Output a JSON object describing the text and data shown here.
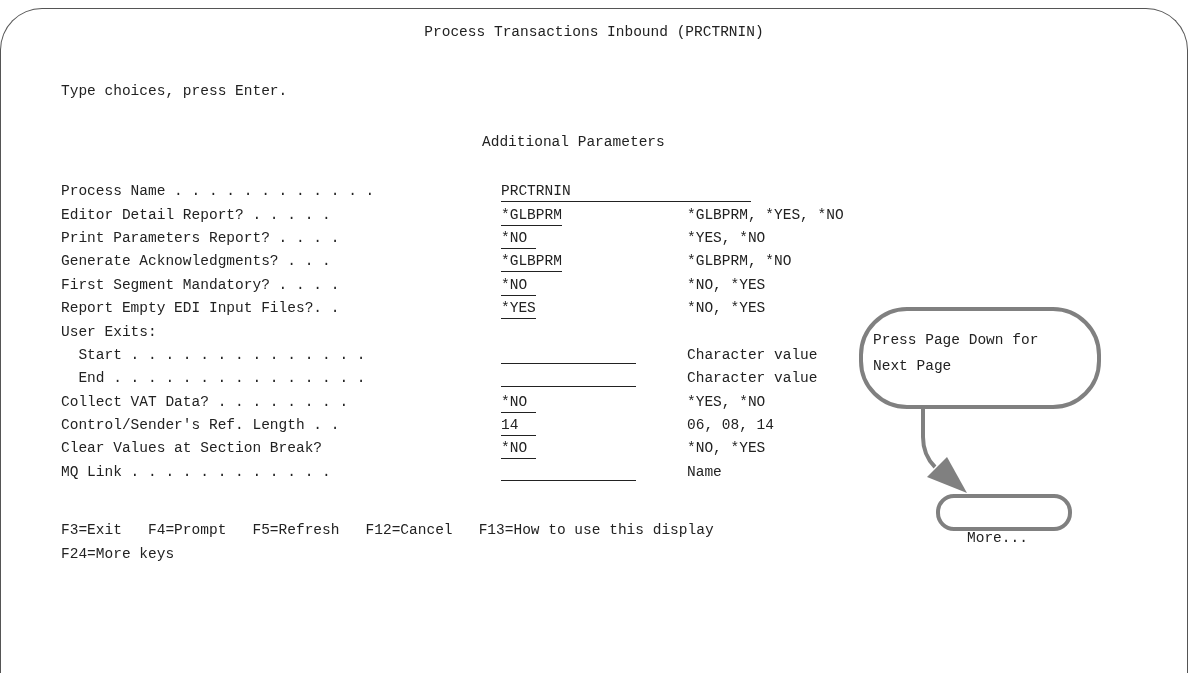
{
  "title": "Process Transactions Inbound (PRCTRNIN)",
  "instruction": "Type choices, press Enter.",
  "section_title": "Additional Parameters",
  "fields": [
    {
      "kind": "input",
      "label": "Process Name . . . . . . . . . . . .",
      "value": "PRCTRNIN"
    },
    {
      "kind": "input",
      "label": "Editor Detail Report? . . . . .",
      "value": "*GLBPRM",
      "hint": "*GLBPRM, *YES, *NO"
    },
    {
      "kind": "input",
      "label": "Print Parameters Report? . . . .",
      "value": "*NO",
      "hint": "*YES, *NO"
    },
    {
      "kind": "input",
      "label": "Generate Acknowledgments? . . .",
      "value": "*GLBPRM",
      "hint": "*GLBPRM, *NO"
    },
    {
      "kind": "input",
      "label": "First Segment Mandatory? . . . .",
      "value": "*NO",
      "hint": "*NO, *YES"
    },
    {
      "kind": "input",
      "label": "Report Empty EDI Input Files?. .",
      "value": "*YES",
      "hint": "*NO, *YES"
    },
    {
      "kind": "group",
      "label": "User Exits:",
      "children": [
        {
          "kind": "input",
          "label": "Start . . . . . . . . . . . . . .",
          "hint": "Character value"
        },
        {
          "kind": "input",
          "label": "End . . . . . . . . . . . . . . .",
          "hint": "Character value"
        }
      ]
    },
    {
      "kind": "input",
      "label": "Collect VAT Data? . . . . . . . .",
      "value": "*NO",
      "hint": "*YES, *NO"
    },
    {
      "kind": "input",
      "label": "Control/Sender's Ref. Length . .",
      "value": "14",
      "hint": "06, 08, 14"
    },
    {
      "kind": "input",
      "label": "Clear Values at Section Break?",
      "value": "*NO",
      "hint": "*NO, *YES"
    },
    {
      "kind": "input",
      "label": "MQ Link . . . . . . . . . . . .",
      "hint": "Name"
    }
  ],
  "more": "More...",
  "function_keys": [
    "F3=Exit",
    "F4=Prompt",
    "F5=Refresh",
    "F12=Cancel",
    "F13=How to use this display",
    "F24=More keys"
  ],
  "callout": {
    "text": "Press Page Down for Next Page"
  }
}
